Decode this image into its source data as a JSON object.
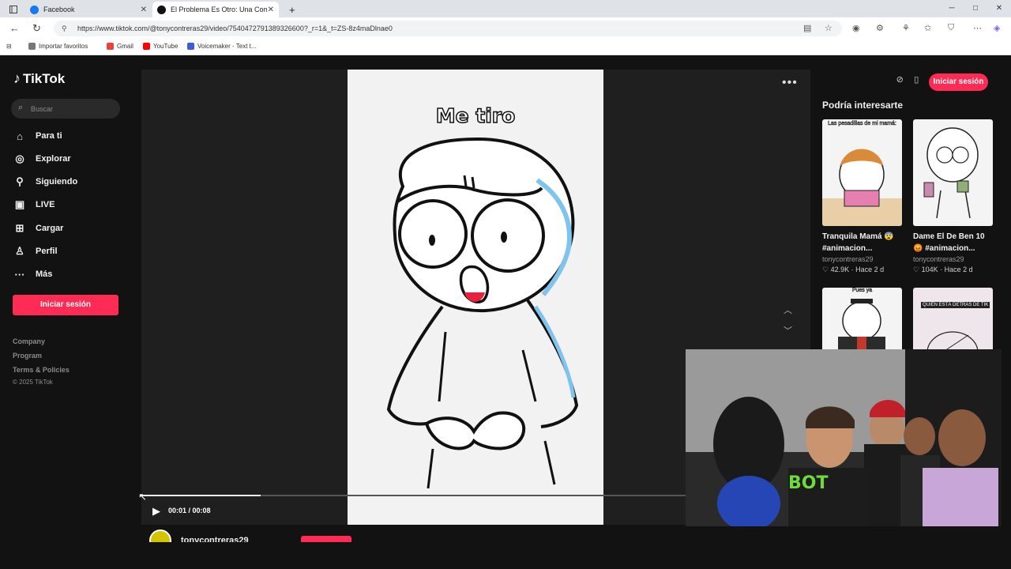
{
  "browser": {
    "tabs": [
      {
        "title": "Facebook",
        "close": "✕",
        "color": "#1877f2"
      },
      {
        "title": "El Problema Es Otro: Una Comedi",
        "close": "✕",
        "color": "#111111"
      }
    ],
    "new_tab": "+",
    "window_controls": [
      "─",
      "□",
      "✕"
    ],
    "url": "https://www.tiktok.com/@tonycontreras29/video/7540472791389326600?_r=1&_t=ZS-8z4maDlnae0",
    "bookmarks": [
      {
        "label": "Importar favoritos",
        "color": "#777777"
      },
      {
        "label": "Gmail",
        "color": "#ea4335"
      },
      {
        "label": "YouTube",
        "color": "#ff0000"
      },
      {
        "label": "Voicemaker - Text t...",
        "color": "#3b5bdb"
      }
    ]
  },
  "sidebar": {
    "logo": "TikTok",
    "search_placeholder": "Buscar",
    "nav": [
      {
        "label": "Para ti",
        "icon": "home-icon"
      },
      {
        "label": "Explorar",
        "icon": "compass-icon"
      },
      {
        "label": "Siguiendo",
        "icon": "following-icon"
      },
      {
        "label": "LIVE",
        "icon": "live-icon"
      },
      {
        "label": "Cargar",
        "icon": "upload-icon"
      },
      {
        "label": "Perfil",
        "icon": "profile-icon"
      },
      {
        "label": "Más",
        "icon": "more-icon"
      }
    ],
    "login_label": "Iniciar sesión",
    "footer": [
      "Company",
      "Program",
      "Terms & Policies"
    ],
    "copyright": "© 2025 TikTok"
  },
  "video": {
    "caption": "Me tiro",
    "time": "00:01 / 00:08",
    "progress": 0.22,
    "author": "tonycontreras29"
  },
  "right": {
    "login_label": "Iniciar sesión",
    "heading": "Podría interesarte",
    "cards": [
      {
        "title_1": "Tranquila Mamá 😨",
        "title_2": "#animacion...",
        "author": "tonycontreras29",
        "likes": "♡ 42.9K · Hace 2 d",
        "thumb_text": "Las pesadillas de mi mamá:"
      },
      {
        "title_1": "Dame El De Ben 10",
        "title_2": "😡 #animacion...",
        "author": "tonycontreras29",
        "likes": "♡ 104K · Hace 2 d",
        "thumb_text": ""
      },
      {
        "thumb_text": "Pues ya"
      },
      {
        "thumb_text": "QUIÉN ESTÁ DETRÁS DE TIK"
      }
    ]
  }
}
